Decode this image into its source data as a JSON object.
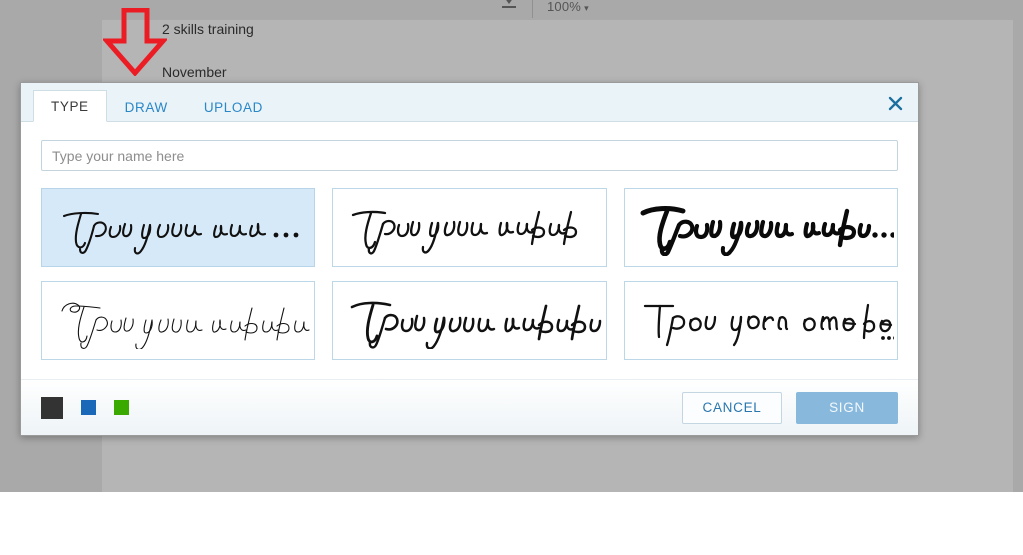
{
  "background": {
    "toolbar": {
      "download_icon": "download-icon",
      "zoom_level": "100%",
      "zoom_caret": "▾"
    },
    "document": {
      "line_1": "2 skills training",
      "line_2": "November"
    },
    "annotation": {
      "shape": "down-arrow",
      "color": "#ec1c24"
    }
  },
  "modal": {
    "tabs": [
      {
        "label": "TYPE",
        "active": true
      },
      {
        "label": "DRAW",
        "active": false
      },
      {
        "label": "UPLOAD",
        "active": false
      }
    ],
    "close_icon": "close-icon",
    "input": {
      "value": "",
      "placeholder": "Type your name here"
    },
    "style_cards": [
      {
        "text": "Type your na...",
        "style": "casual-script",
        "selected": true
      },
      {
        "text": "Type your name here",
        "style": "slanted-marker",
        "selected": false
      },
      {
        "text": "Type your name he...",
        "style": "bold-brush",
        "selected": false
      },
      {
        "text": "Type your name here",
        "style": "thin-copperplate",
        "selected": false
      },
      {
        "text": "Type your name here",
        "style": "elegant-calligraphy",
        "selected": false
      },
      {
        "text": "Type your name he...",
        "style": "print-handwriting",
        "selected": false
      }
    ],
    "colors": [
      {
        "name": "black",
        "hex": "#333333",
        "selected": true
      },
      {
        "name": "blue",
        "hex": "#1a68b8",
        "selected": false
      },
      {
        "name": "green",
        "hex": "#3aaa00",
        "selected": false
      }
    ],
    "cancel_label": "CANCEL",
    "sign_label": "SIGN"
  }
}
